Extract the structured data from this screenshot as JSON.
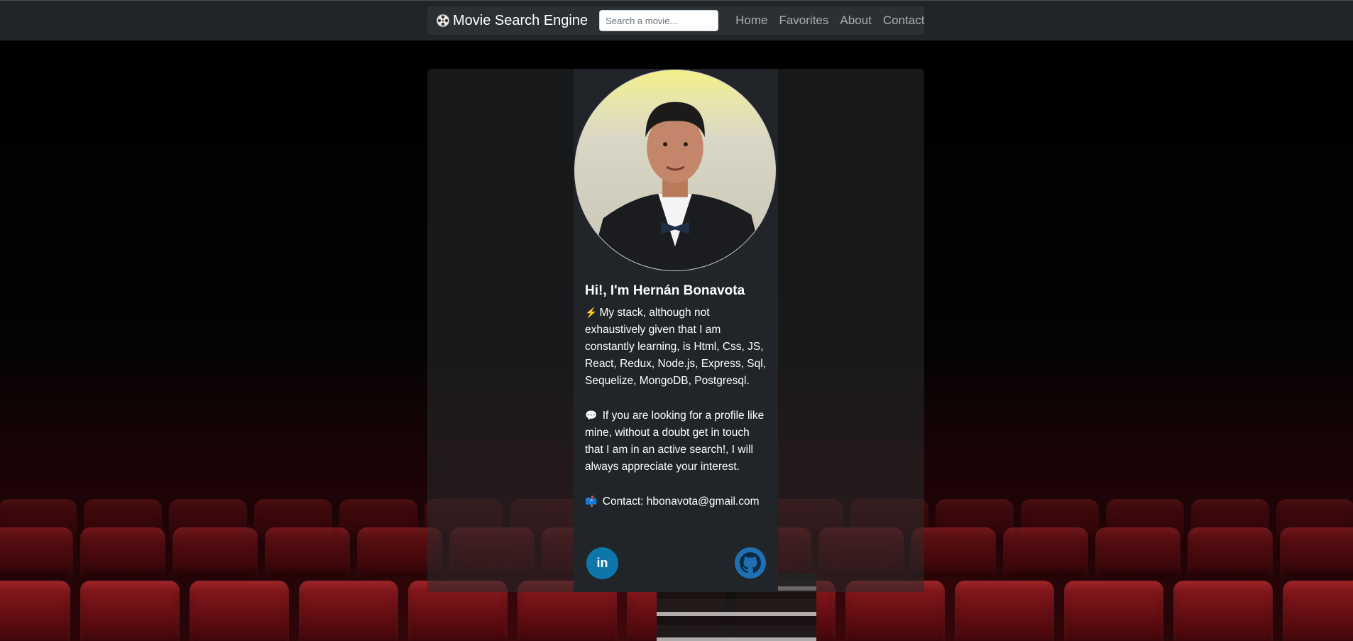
{
  "navbar": {
    "brand": "Movie Search Engine",
    "brand_icon": "film-reel-icon",
    "search_placeholder": "Search a movie...",
    "links": [
      "Home",
      "Favorites",
      "About",
      "Contact"
    ]
  },
  "profile": {
    "heading": "Hi!, I'm Hernán Bonavota",
    "stack_emoji": "⚡",
    "stack_text": "My stack, although not exhaustively given that I am constantly learning, is Html, Css, JS, React, Redux, Node.js, Express, Sql, Sequelize, MongoDB, Postgresql.",
    "search_emoji": "💬",
    "search_text": "If you are looking for a profile like mine, without a doubt get in touch that I am in an active search!, I will always appreciate your interest.",
    "contact_emoji": "📫",
    "contact_text": "Contact: hbonavota@gmail.com",
    "linkedin_label": "in"
  },
  "colors": {
    "navbar_bg": "#212529",
    "card_bg": "#212529",
    "linkedin_blue": "#0e76a8",
    "github_blue": "#1f6fb2",
    "seat_red": "#8e1a1f"
  }
}
